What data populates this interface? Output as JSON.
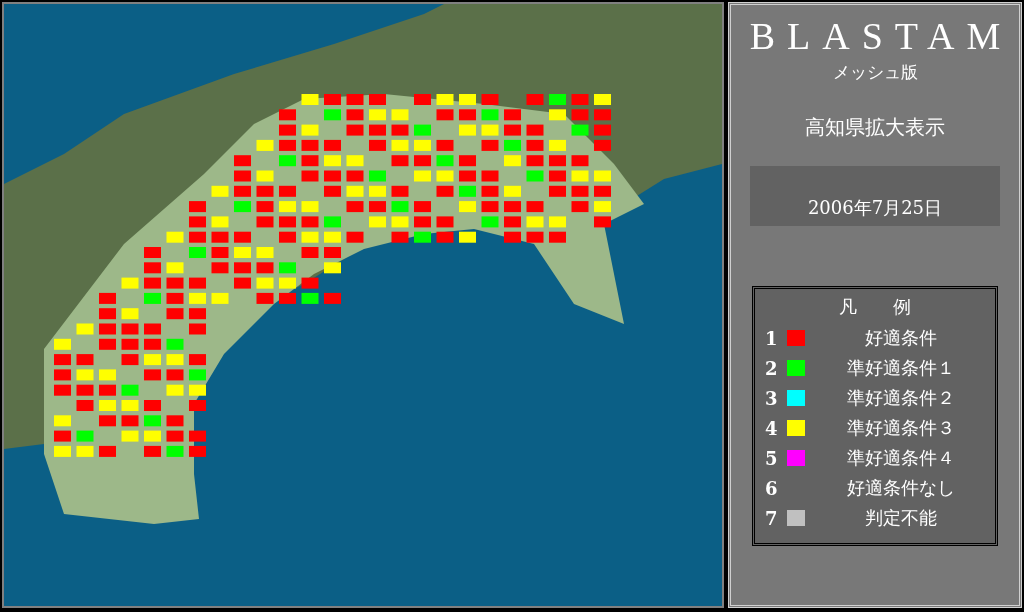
{
  "panel": {
    "title": "BLASTAM",
    "subtitle": "メッシュ版",
    "view": "高知県拡大表示",
    "date": "2006年7月25日"
  },
  "legend": {
    "title": "凡　　例",
    "items": [
      {
        "number": "1",
        "label": "好適条件",
        "color": "#ff0000"
      },
      {
        "number": "2",
        "label": "準好適条件１",
        "color": "#00ff00"
      },
      {
        "number": "3",
        "label": "準好適条件２",
        "color": "#00ffff"
      },
      {
        "number": "4",
        "label": "準好適条件３",
        "color": "#ffff00"
      },
      {
        "number": "5",
        "label": "準好適条件４",
        "color": "#ff00ff"
      },
      {
        "number": "6",
        "label": "好適条件なし"
      },
      {
        "number": "7",
        "label": "判定不能",
        "color": "#c0c0c0"
      }
    ]
  }
}
